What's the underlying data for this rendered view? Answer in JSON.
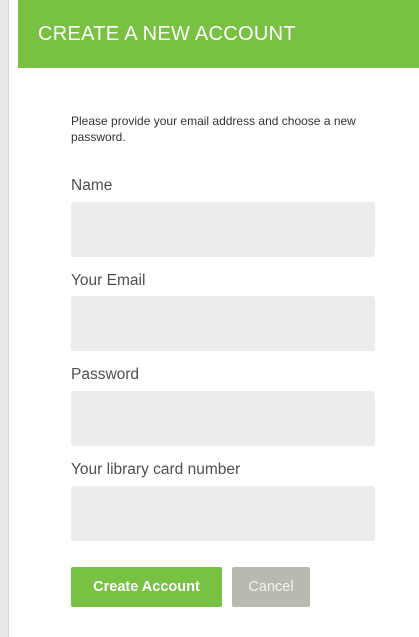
{
  "header": {
    "title": "CREATE A NEW ACCOUNT"
  },
  "form": {
    "intro": "Please provide your email address and choose a new password.",
    "fields": {
      "name": {
        "label": "Name",
        "value": "",
        "placeholder": ""
      },
      "email": {
        "label": "Your Email",
        "value": "",
        "placeholder": ""
      },
      "password": {
        "label": "Password",
        "value": "",
        "placeholder": ""
      },
      "library_card": {
        "label": "Your library card number",
        "value": "",
        "placeholder": ""
      }
    },
    "buttons": {
      "create_label": "Create Account",
      "cancel_label": "Cancel"
    }
  },
  "colors": {
    "accent": "#78c142",
    "input_bg": "#ececec",
    "cancel_bg": "#b9b9b1"
  }
}
